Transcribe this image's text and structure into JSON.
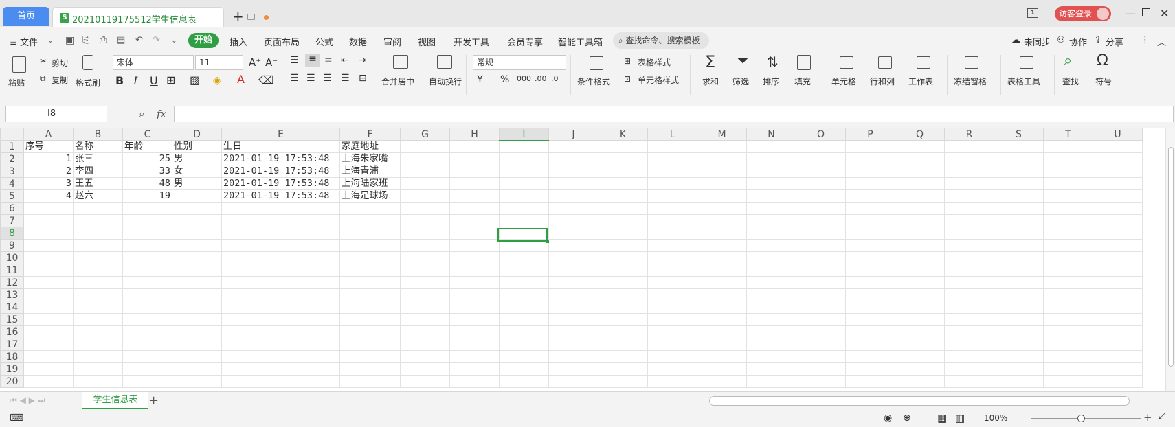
{
  "titlebar": {
    "home_tab": "首页",
    "doc_tab": "20210119175512学生信息表",
    "doc_icon_letter": "S",
    "window_badge": "1",
    "login_label": "访客登录"
  },
  "menu": {
    "file": "≡ 文件",
    "start": "开始",
    "items": [
      "插入",
      "页面布局",
      "公式",
      "数据",
      "审阅",
      "视图",
      "开发工具",
      "会员专享",
      "智能工具箱"
    ],
    "search": "查找命令、搜索模板",
    "sync": "未同步",
    "collab": "协作",
    "share": "分享"
  },
  "ribbon": {
    "paste": "粘贴",
    "cut": "剪切",
    "copy": "复制",
    "format_painter": "格式刷",
    "font_name": "宋体",
    "font_size": "11",
    "merge_center": "合并居中",
    "wrap_text": "自动换行",
    "number_format": "常规",
    "cond_format": "条件格式",
    "table_style": "表格样式",
    "cell_style": "单元格样式",
    "sum": "求和",
    "filter": "筛选",
    "sort": "排序",
    "fill": "填充",
    "cells": "单元格",
    "row_col": "行和列",
    "worksheet": "工作表",
    "freeze": "冻结窗格",
    "table_tools": "表格工具",
    "find": "查找",
    "symbol": "符号"
  },
  "formula_bar": {
    "name_box": "I8",
    "fx": "fx",
    "value": ""
  },
  "sheet": {
    "columns": [
      "A",
      "B",
      "C",
      "D",
      "E",
      "F",
      "G",
      "H",
      "I",
      "J",
      "K",
      "L",
      "M",
      "N",
      "O",
      "P",
      "Q",
      "R",
      "S",
      "T",
      "U"
    ],
    "row_numbers": [
      "1",
      "2",
      "3",
      "4",
      "5",
      "6",
      "7",
      "8",
      "9",
      "10",
      "11",
      "12",
      "13",
      "14",
      "15",
      "16",
      "17",
      "18",
      "19",
      "20"
    ],
    "header": [
      "序号",
      "名称",
      "年龄",
      "性别",
      "生日",
      "家庭地址"
    ],
    "rows": [
      [
        "1",
        "张三",
        "25",
        "男",
        "2021-01-19 17:53:48",
        "上海朱家嘴"
      ],
      [
        "2",
        "李四",
        "33",
        "女",
        "2021-01-19 17:53:48",
        "上海青浦"
      ],
      [
        "3",
        "王五",
        "48",
        "男",
        "2021-01-19 17:53:48",
        "上海陆家班"
      ],
      [
        "4",
        "赵六",
        "19",
        "",
        "2021-01-19 17:53:48",
        "上海足球场"
      ]
    ],
    "selected_cell": "I8",
    "active_color": "#2f9e44"
  },
  "sheet_tabs": {
    "active": "学生信息表",
    "add": "+"
  },
  "status": {
    "zoom": "100%"
  }
}
